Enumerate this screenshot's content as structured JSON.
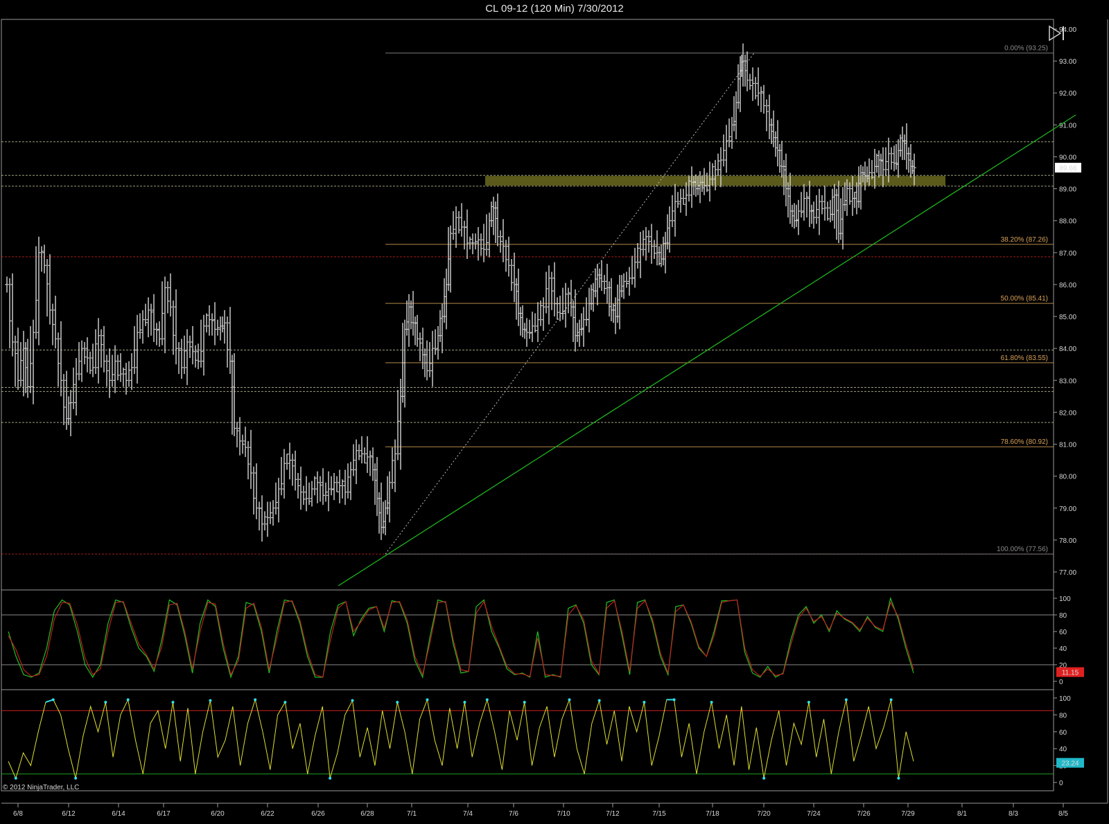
{
  "title": "CL 09-12 (120 Min)  7/30/2012",
  "copyright": "© 2012 NinjaTrader, LLC",
  "colors": {
    "background": "#000000",
    "frame": "#9a9a9a",
    "bars": "#d8d8d8",
    "trendline": "#1fb31f",
    "fib_line": "#b58a4a",
    "fib_label": "#d8a35a",
    "fib_extreme": "#7a7a7a",
    "zone": "#6b6a1e",
    "level_white": "#c8c8a0",
    "level_red": "#d02020",
    "stoch_k": "#21c121",
    "stoch_d": "#c02020",
    "rsi_line": "#e0e030",
    "rsi_high": "#30e0e8",
    "upper_ref": "#d02020",
    "lower_ref": "#20a020"
  },
  "toolbar": {
    "play_icon": "step-forward-icon"
  },
  "price_badge": "89.66",
  "stoch_badge": "11.15",
  "rsi_badge": "23.24",
  "chart_data": [
    {
      "type": "ohlc",
      "panel": "price",
      "ylim": [
        76.5,
        94.2
      ],
      "y_ticks": [
        "94.00",
        "93.00",
        "92.00",
        "91.00",
        "90.00",
        "89.00",
        "88.00",
        "87.00",
        "86.00",
        "85.00",
        "84.00",
        "83.00",
        "82.00",
        "81.00",
        "80.00",
        "79.00",
        "78.00",
        "77.00"
      ],
      "x_ticks": [
        "6/8",
        "6/12",
        "6/14",
        "6/17",
        "6/20",
        "6/22",
        "6/26",
        "6/28",
        "7/1",
        "7/4",
        "7/6",
        "7/10",
        "7/12",
        "7/15",
        "7/18",
        "7/20",
        "7/24",
        "7/26",
        "7/29",
        "8/1",
        "8/3",
        "8/5"
      ],
      "price_path": [
        [
          6,
          86.0
        ],
        [
          14,
          84.2
        ],
        [
          22,
          83.0
        ],
        [
          30,
          84.0
        ],
        [
          36,
          82.8
        ],
        [
          44,
          84.5
        ],
        [
          52,
          87.0
        ],
        [
          60,
          86.6
        ],
        [
          68,
          85.2
        ],
        [
          76,
          84.3
        ],
        [
          84,
          83.0
        ],
        [
          92,
          81.8
        ],
        [
          98,
          82.3
        ],
        [
          106,
          83.2
        ],
        [
          114,
          84.0
        ],
        [
          122,
          83.7
        ],
        [
          130,
          83.4
        ],
        [
          138,
          84.4
        ],
        [
          146,
          83.6
        ],
        [
          154,
          83.0
        ],
        [
          162,
          83.6
        ],
        [
          170,
          83.2
        ],
        [
          178,
          83.0
        ],
        [
          186,
          83.4
        ],
        [
          194,
          84.5
        ],
        [
          202,
          84.9
        ],
        [
          210,
          85.2
        ],
        [
          218,
          84.6
        ],
        [
          226,
          84.3
        ],
        [
          234,
          85.9
        ],
        [
          242,
          85.3
        ],
        [
          250,
          84.0
        ],
        [
          258,
          83.4
        ],
        [
          266,
          84.2
        ],
        [
          274,
          83.9
        ],
        [
          282,
          83.6
        ],
        [
          290,
          84.7
        ],
        [
          298,
          84.9
        ],
        [
          306,
          84.6
        ],
        [
          314,
          84.7
        ],
        [
          320,
          84.8
        ],
        [
          328,
          83.6
        ],
        [
          334,
          81.5
        ],
        [
          342,
          81.1
        ],
        [
          350,
          80.9
        ],
        [
          358,
          80.1
        ],
        [
          366,
          79.0
        ],
        [
          374,
          78.5
        ],
        [
          382,
          78.7
        ],
        [
          390,
          79.0
        ],
        [
          398,
          79.6
        ],
        [
          406,
          80.4
        ],
        [
          414,
          80.5
        ],
        [
          422,
          79.9
        ],
        [
          430,
          79.5
        ],
        [
          438,
          79.3
        ],
        [
          446,
          79.6
        ],
        [
          454,
          79.8
        ],
        [
          462,
          79.4
        ],
        [
          470,
          79.6
        ],
        [
          478,
          79.8
        ],
        [
          486,
          79.7
        ],
        [
          494,
          79.5
        ],
        [
          502,
          80.2
        ],
        [
          510,
          80.8
        ],
        [
          518,
          80.7
        ],
        [
          526,
          80.6
        ],
        [
          534,
          80.2
        ],
        [
          540,
          79.3
        ],
        [
          546,
          78.4
        ],
        [
          552,
          79.0
        ],
        [
          558,
          79.8
        ],
        [
          566,
          80.7
        ],
        [
          574,
          82.5
        ],
        [
          580,
          84.6
        ],
        [
          586,
          85.3
        ],
        [
          592,
          84.8
        ],
        [
          598,
          84.3
        ],
        [
          606,
          83.8
        ],
        [
          612,
          83.3
        ],
        [
          620,
          84.0
        ],
        [
          628,
          84.4
        ],
        [
          634,
          85.0
        ],
        [
          640,
          86.0
        ],
        [
          646,
          87.6
        ],
        [
          654,
          88.1
        ],
        [
          662,
          87.8
        ],
        [
          670,
          87.3
        ],
        [
          678,
          87.3
        ],
        [
          686,
          87.4
        ],
        [
          694,
          87.1
        ],
        [
          702,
          88.0
        ],
        [
          708,
          88.4
        ],
        [
          714,
          87.5
        ],
        [
          722,
          87.2
        ],
        [
          730,
          86.6
        ],
        [
          738,
          86.0
        ],
        [
          744,
          85.1
        ],
        [
          750,
          84.6
        ],
        [
          756,
          84.5
        ],
        [
          764,
          84.7
        ],
        [
          772,
          84.9
        ],
        [
          780,
          85.3
        ],
        [
          788,
          86.2
        ],
        [
          796,
          85.4
        ],
        [
          804,
          85.1
        ],
        [
          812,
          85.7
        ],
        [
          820,
          85.3
        ],
        [
          826,
          84.4
        ],
        [
          832,
          84.6
        ],
        [
          838,
          84.9
        ],
        [
          846,
          85.4
        ],
        [
          852,
          85.8
        ],
        [
          858,
          86.3
        ],
        [
          864,
          86.1
        ],
        [
          872,
          85.9
        ],
        [
          878,
          85.2
        ],
        [
          884,
          85.0
        ],
        [
          890,
          85.8
        ],
        [
          896,
          86.1
        ],
        [
          904,
          86.2
        ],
        [
          912,
          86.7
        ],
        [
          920,
          87.1
        ],
        [
          928,
          87.5
        ],
        [
          936,
          87.2
        ],
        [
          944,
          87.0
        ],
        [
          950,
          86.8
        ],
        [
          956,
          87.3
        ],
        [
          962,
          88.0
        ],
        [
          970,
          88.6
        ],
        [
          978,
          88.7
        ],
        [
          986,
          88.8
        ],
        [
          994,
          89.2
        ],
        [
          1000,
          89.0
        ],
        [
          1006,
          89.2
        ],
        [
          1012,
          89.1
        ],
        [
          1020,
          89.3
        ],
        [
          1028,
          89.6
        ],
        [
          1036,
          89.9
        ],
        [
          1044,
          90.5
        ],
        [
          1052,
          91.0
        ],
        [
          1058,
          91.7
        ],
        [
          1064,
          92.7
        ],
        [
          1068,
          93.0
        ],
        [
          1074,
          92.4
        ],
        [
          1082,
          92.3
        ],
        [
          1090,
          92.0
        ],
        [
          1098,
          91.6
        ],
        [
          1106,
          91.0
        ],
        [
          1112,
          90.6
        ],
        [
          1118,
          90.2
        ],
        [
          1124,
          89.7
        ],
        [
          1130,
          89.0
        ],
        [
          1136,
          88.3
        ],
        [
          1142,
          88.0
        ],
        [
          1148,
          88.3
        ],
        [
          1156,
          88.7
        ],
        [
          1164,
          88.3
        ],
        [
          1170,
          88.1
        ],
        [
          1178,
          88.6
        ],
        [
          1186,
          88.4
        ],
        [
          1194,
          88.2
        ],
        [
          1200,
          88.8
        ],
        [
          1206,
          87.6
        ],
        [
          1212,
          88.5
        ],
        [
          1218,
          89.0
        ],
        [
          1226,
          88.7
        ],
        [
          1232,
          88.6
        ],
        [
          1238,
          89.5
        ],
        [
          1244,
          89.4
        ],
        [
          1250,
          89.5
        ],
        [
          1258,
          89.7
        ],
        [
          1264,
          89.9
        ],
        [
          1270,
          89.6
        ],
        [
          1278,
          90.1
        ],
        [
          1286,
          89.8
        ],
        [
          1292,
          90.2
        ],
        [
          1298,
          90.5
        ],
        [
          1304,
          90.1
        ],
        [
          1310,
          89.7
        ],
        [
          1315,
          89.66
        ]
      ],
      "fib_levels": [
        {
          "label": "0.00% (93.25)",
          "price": 93.25
        },
        {
          "label": "38.20% (87.26)",
          "price": 87.26
        },
        {
          "label": "50.00% (85.41)",
          "price": 85.41
        },
        {
          "label": "61.80% (83.55)",
          "price": 83.55
        },
        {
          "label": "78.60% (80.92)",
          "price": 80.92
        },
        {
          "label": "100.00% (77.56)",
          "price": 77.56
        }
      ],
      "horizontal_levels": [
        {
          "price": 90.47,
          "style": "white"
        },
        {
          "price": 89.42,
          "style": "white"
        },
        {
          "price": 89.08,
          "style": "white"
        },
        {
          "price": 86.87,
          "style": "red"
        },
        {
          "price": 83.95,
          "style": "white"
        },
        {
          "price": 82.78,
          "style": "white"
        },
        {
          "price": 82.65,
          "style": "white"
        },
        {
          "price": 81.68,
          "style": "white"
        },
        {
          "price": 77.56,
          "style": "red"
        }
      ],
      "zone": {
        "price_low": 89.1,
        "price_high": 89.4
      },
      "last_price": 89.66
    },
    {
      "type": "line",
      "panel": "stochastics",
      "ylim": [
        0,
        100
      ],
      "y_ticks": [
        "100",
        "80",
        "60",
        "40",
        "20",
        "0"
      ],
      "ref_lines": [
        80,
        20
      ],
      "series": [
        {
          "role": "K",
          "values": [
            60,
            30,
            8,
            5,
            10,
            40,
            85,
            98,
            92,
            60,
            20,
            5,
            20,
            70,
            98,
            95,
            65,
            40,
            30,
            12,
            50,
            98,
            92,
            55,
            10,
            70,
            98,
            90,
            40,
            5,
            30,
            95,
            92,
            60,
            10,
            60,
            98,
            96,
            70,
            30,
            5,
            5,
            60,
            92,
            96,
            55,
            75,
            88,
            90,
            60,
            97,
            95,
            70,
            25,
            5,
            55,
            98,
            95,
            45,
            10,
            12,
            90,
            98,
            60,
            40,
            15,
            8,
            10,
            5,
            60,
            5,
            8,
            5,
            88,
            92,
            70,
            20,
            8,
            95,
            98,
            55,
            8,
            95,
            98,
            70,
            30,
            8,
            90,
            92,
            70,
            40,
            30,
            60,
            97,
            97,
            98,
            35,
            10,
            5,
            18,
            5,
            10,
            50,
            80,
            90,
            70,
            80,
            60,
            85,
            75,
            70,
            60,
            78,
            65,
            60,
            100,
            75,
            40,
            10
          ]
        },
        {
          "role": "D",
          "values": [
            55,
            38,
            14,
            6,
            8,
            30,
            75,
            95,
            94,
            68,
            28,
            8,
            15,
            60,
            95,
            96,
            70,
            45,
            32,
            15,
            42,
            92,
            94,
            60,
            15,
            60,
            95,
            93,
            46,
            8,
            25,
            88,
            94,
            65,
            14,
            52,
            95,
            97,
            74,
            35,
            8,
            5,
            50,
            88,
            96,
            60,
            72,
            86,
            90,
            64,
            95,
            96,
            74,
            30,
            8,
            48,
            95,
            96,
            50,
            14,
            12,
            82,
            96,
            66,
            42,
            18,
            9,
            9,
            6,
            52,
            8,
            7,
            6,
            80,
            91,
            74,
            25,
            9,
            88,
            97,
            60,
            12,
            88,
            97,
            74,
            34,
            10,
            84,
            92,
            72,
            42,
            30,
            55,
            95,
            97,
            98,
            40,
            14,
            6,
            15,
            7,
            9,
            44,
            76,
            88,
            72,
            78,
            62,
            82,
            76,
            71,
            62,
            76,
            66,
            62,
            95,
            78,
            45,
            14
          ]
        }
      ],
      "last_value": 11.15
    },
    {
      "type": "line",
      "panel": "rsi",
      "ylim": [
        0,
        100
      ],
      "y_ticks": [
        "100",
        "80",
        "60",
        "40",
        "20",
        "0"
      ],
      "ref_lines": [
        85,
        10
      ],
      "series": [
        {
          "role": "RSI",
          "values": [
            25,
            5,
            35,
            20,
            60,
            95,
            98,
            80,
            40,
            5,
            55,
            90,
            60,
            95,
            30,
            80,
            98,
            50,
            10,
            70,
            85,
            40,
            95,
            25,
            88,
            10,
            60,
            97,
            30,
            50,
            90,
            20,
            70,
            98,
            60,
            15,
            80,
            95,
            40,
            70,
            10,
            55,
            90,
            5,
            35,
            80,
            97,
            30,
            65,
            20,
            85,
            40,
            95,
            60,
            10,
            75,
            98,
            50,
            20,
            88,
            40,
            95,
            30,
            70,
            98,
            60,
            15,
            85,
            50,
            95,
            20,
            65,
            90,
            30,
            75,
            98,
            40,
            10,
            70,
            97,
            45,
            85,
            25,
            90,
            60,
            95,
            20,
            55,
            98,
            98,
            30,
            70,
            10,
            60,
            95,
            40,
            80,
            20,
            90,
            15,
            65,
            5,
            50,
            85,
            20,
            70,
            45,
            95,
            30,
            75,
            10,
            60,
            98,
            25,
            55,
            90,
            40,
            65,
            98,
            5,
            60,
            25
          ]
        }
      ],
      "last_value": 23.24
    }
  ]
}
